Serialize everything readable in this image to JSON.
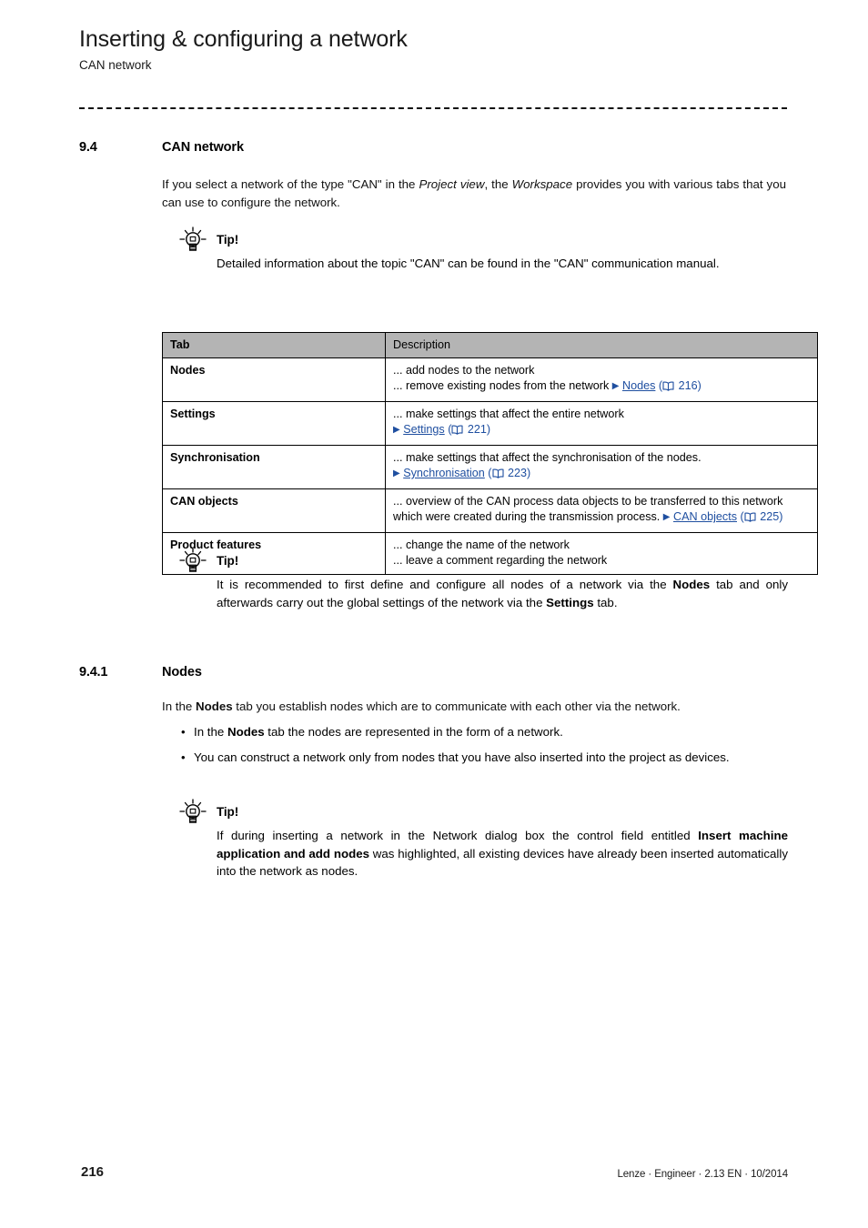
{
  "header": {
    "title": "Inserting & configuring a network",
    "subtitle": "CAN network"
  },
  "section_94": {
    "number": "9.4",
    "title": "CAN network",
    "intro_1": "If you select a network of the type \"CAN\" in the ",
    "intro_em1": "Project view",
    "intro_2": ", the ",
    "intro_em2": "Workspace",
    "intro_3": " provides you with various tabs that you can use to configure the network."
  },
  "tip1": {
    "label": "Tip!",
    "text": "Detailed information about the topic \"CAN\" can be found in the \"CAN\" communication manual."
  },
  "table": {
    "headers": [
      "Tab",
      "Description"
    ],
    "rows": [
      {
        "tab": "Nodes",
        "lines": [
          {
            "text": "... add nodes to the network"
          },
          {
            "text": "... remove existing nodes from the network ",
            "link": "Nodes",
            "page": "216"
          }
        ]
      },
      {
        "tab": "Settings",
        "lines": [
          {
            "text": "... make settings that affect the entire network"
          },
          {
            "text": "",
            "link": "Settings",
            "page": "221"
          }
        ]
      },
      {
        "tab": "Synchronisation",
        "lines": [
          {
            "text": "... make settings that affect the synchronisation of the nodes."
          },
          {
            "text": "",
            "link": "Synchronisation",
            "page": "223"
          }
        ]
      },
      {
        "tab": "CAN objects",
        "lines": [
          {
            "text": "... overview of the CAN process data objects to be transferred to this network which were created during the transmission process. ",
            "link": "CAN objects",
            "page": "225"
          }
        ]
      },
      {
        "tab": "Product features",
        "lines": [
          {
            "text": "... change the name of the network"
          },
          {
            "text": "... leave a comment regarding the network"
          }
        ]
      }
    ]
  },
  "tip2": {
    "label": "Tip!",
    "p1": "It is recommended to first define and configure all nodes of a network via the ",
    "b1": "Nodes",
    "p2": " tab and only afterwards carry out the global settings of the network via the ",
    "b2": "Settings",
    "p3": " tab."
  },
  "section_941": {
    "number": "9.4.1",
    "title": "Nodes",
    "intro_1": "In the ",
    "intro_b": "Nodes",
    "intro_2": " tab you establish nodes which are to communicate with each other via the network.",
    "bullets": [
      {
        "pre": "In the ",
        "bold": "Nodes",
        "post": " tab the nodes are represented in the form of a network."
      },
      {
        "pre": "You can construct a network only from nodes that you have also inserted into the project as devices.",
        "bold": "",
        "post": ""
      }
    ]
  },
  "tip3": {
    "label": "Tip!",
    "p1": "If during inserting a network in the Network dialog box the control field entitled ",
    "b1": "Insert machine application and add nodes",
    "p2": " was highlighted, all existing devices have already been inserted automatically into the network as nodes."
  },
  "footer": {
    "page_number": "216",
    "meta": "Lenze · Engineer · 2.13 EN · 10/2014"
  },
  "colors": {
    "link": "#1f4fa0",
    "table_header_bg": "#b4b4b4",
    "text": "#111111"
  }
}
